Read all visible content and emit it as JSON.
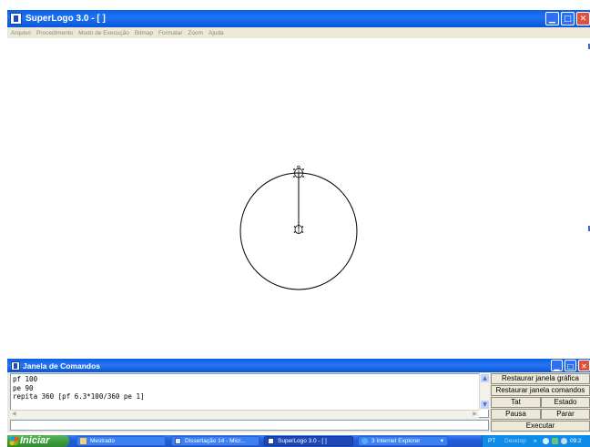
{
  "window": {
    "title": "SuperLogo 3.0 - [ ]",
    "menu": [
      "Arquivo",
      "Procedimento",
      "Modo de Execução",
      "Bitmap",
      "Formatar",
      "Zoom",
      "Ajuda"
    ]
  },
  "commands_window": {
    "title": "Janela de Comandos",
    "lines": [
      "pf 100",
      "pe 90",
      "repita 360 [pf 6.3*100/360 pe 1]"
    ],
    "input_value": "",
    "buttons": {
      "restore_graphic": "Restaurar janela gráfica",
      "restore_commands": "Restaurar janela comandos",
      "tat": "Tat",
      "state": "Estado",
      "pause": "Pausa",
      "stop": "Parar",
      "execute": "Executar"
    }
  },
  "taskbar": {
    "start_label": "Iniciar",
    "tasks": [
      "Mestrado",
      "Dissertação 14 - Micr...",
      "SuperLogo 3.0 - [ ]",
      "3 Internet Explorer"
    ],
    "tray_lang": "PT",
    "tray_desktop": "Desktop",
    "clock": "09:2"
  },
  "colors": {
    "titlebar": "#0a5fe8",
    "window_bg": "#ece9d8",
    "taskbar": "#245edb",
    "start_button": "#3a9a3a"
  },
  "icons": {
    "app": "superlogo-icon",
    "turtle": "turtle-icon",
    "minimize": "minimize-icon",
    "maximize": "maximize-icon",
    "close": "close-icon"
  }
}
